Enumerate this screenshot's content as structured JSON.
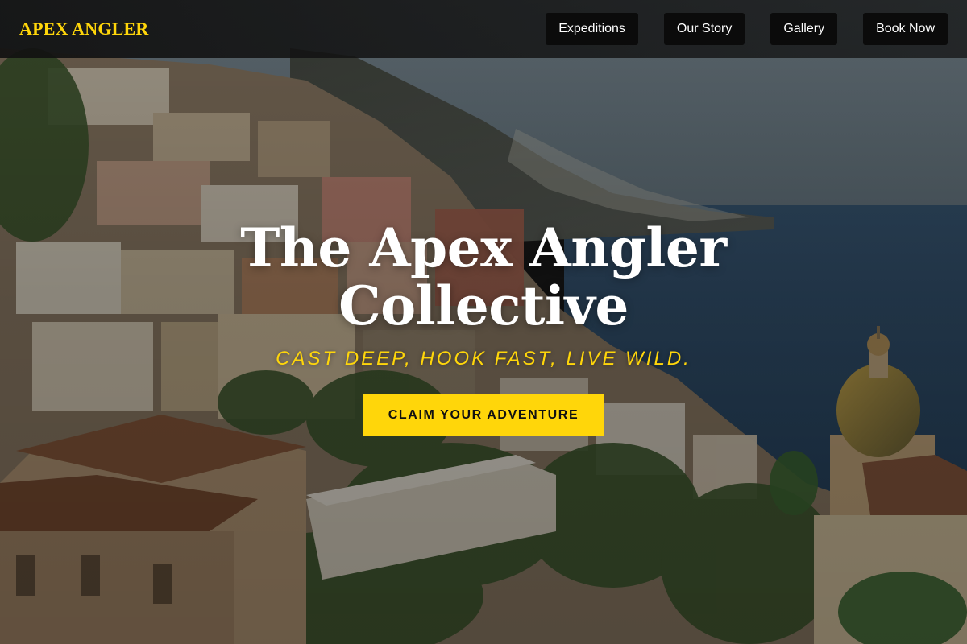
{
  "colors": {
    "accent": "#ffd60a",
    "header_bg": "#111111",
    "nav_item_bg": "#0b0b0b",
    "sea": "#2f4f6e",
    "sky": "#6c7c87"
  },
  "header": {
    "logo_text": "APEX ANGLER",
    "nav": [
      {
        "label": "Expeditions"
      },
      {
        "label": "Our Story"
      },
      {
        "label": "Gallery"
      },
      {
        "label": "Book Now"
      }
    ]
  },
  "hero": {
    "background_image": "coastal-cliffside-village-photo",
    "title_line1": "The Apex Angler",
    "title_line2": "Collective",
    "tagline": "CAST DEEP, HOOK FAST, LIVE WILD.",
    "cta_label": "CLAIM YOUR ADVENTURE"
  }
}
